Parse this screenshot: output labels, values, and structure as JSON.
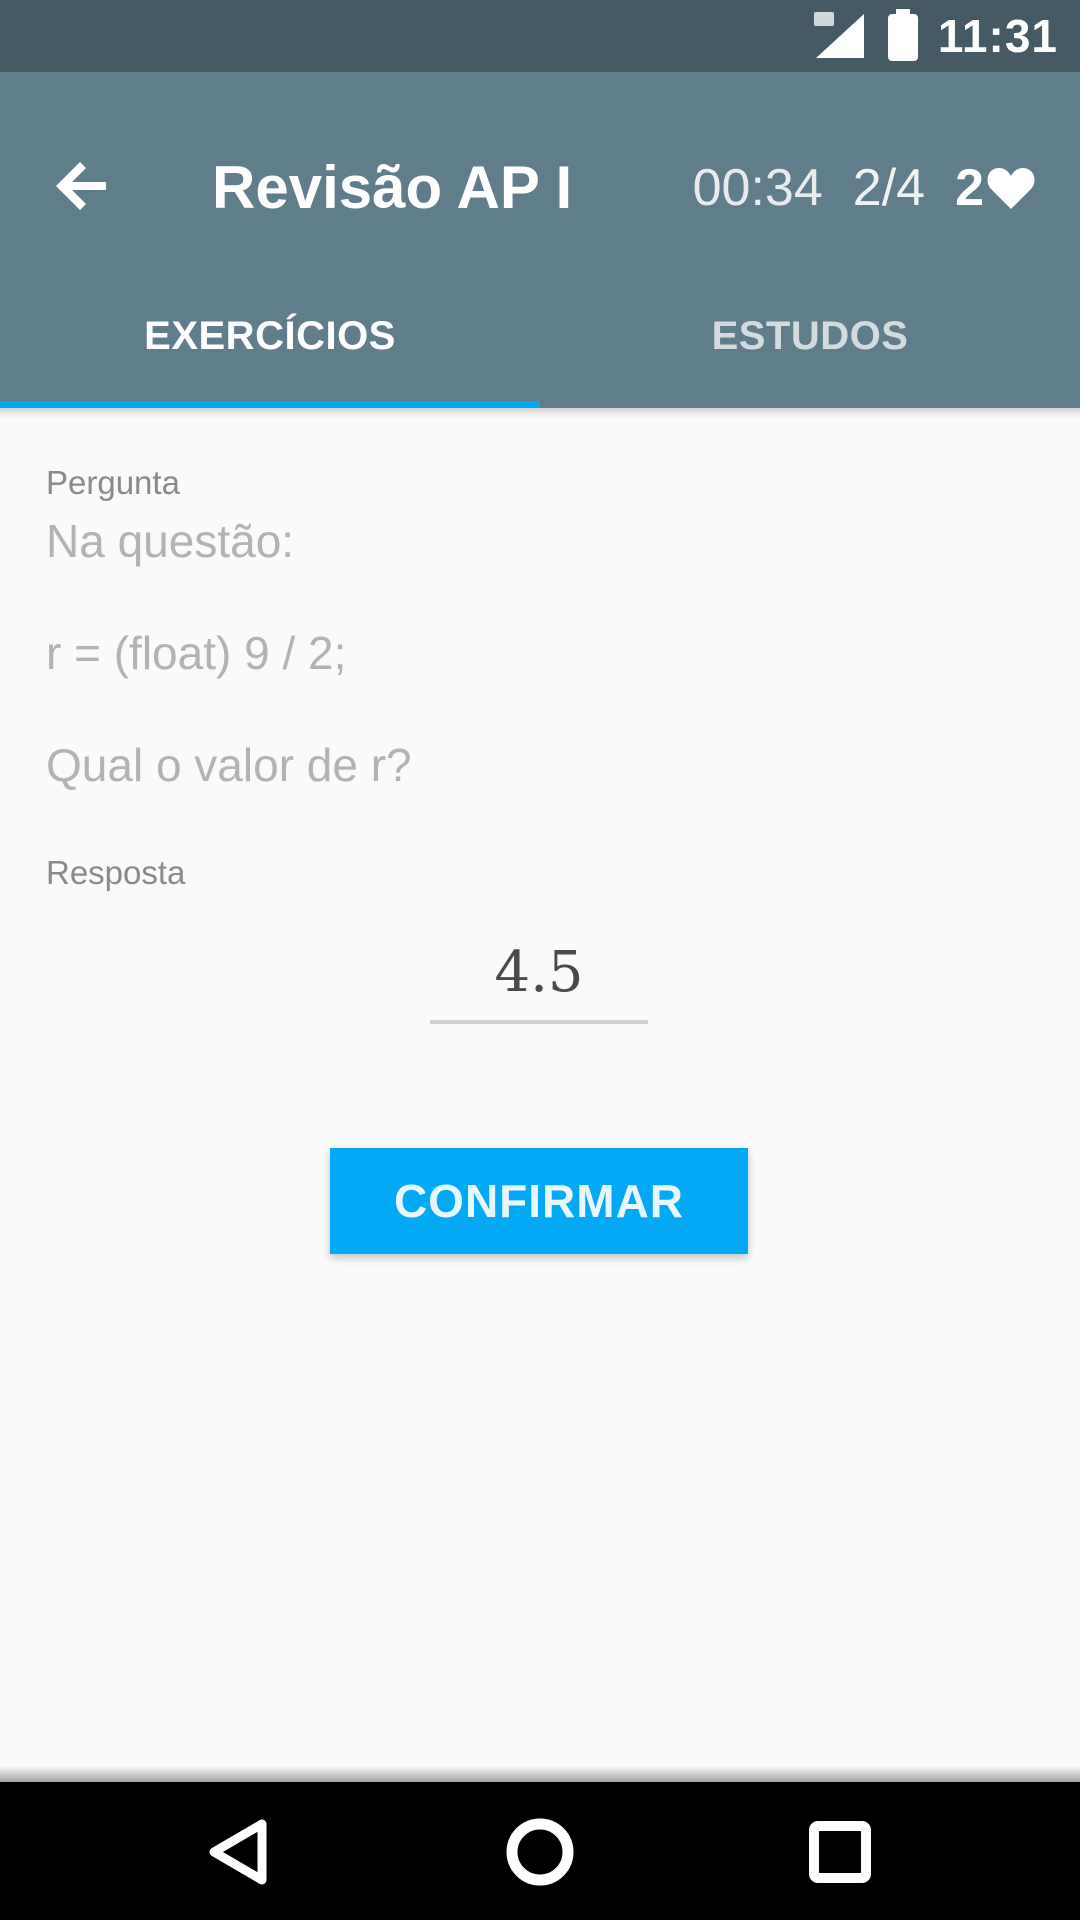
{
  "status_bar": {
    "time": "11:31",
    "icons": [
      "signal-icon",
      "battery-icon"
    ]
  },
  "app_bar": {
    "back_icon": "arrow-left-icon",
    "title": "Revisão AP I",
    "timer": "00:34",
    "progress": "2/4",
    "lives": "2",
    "lives_icon": "heart-icon",
    "color": "#607d8b"
  },
  "tabs": [
    {
      "label": "EXERCÍCIOS",
      "selected": true
    },
    {
      "label": "ESTUDOS",
      "selected": false
    }
  ],
  "exercise": {
    "question_label": "Pergunta",
    "question_lines": [
      "Na questão:",
      "r = (float) 9 / 2;",
      "Qual o valor de r?"
    ],
    "answer_label": "Resposta",
    "answer_value": "4.5",
    "confirm_label": "CONFIRMAR"
  },
  "colors": {
    "accent": "#03a9f4",
    "status_bar": "#455a64"
  },
  "nav_bar": {
    "icons": [
      "nav-back-icon",
      "nav-home-icon",
      "nav-recents-icon"
    ]
  }
}
